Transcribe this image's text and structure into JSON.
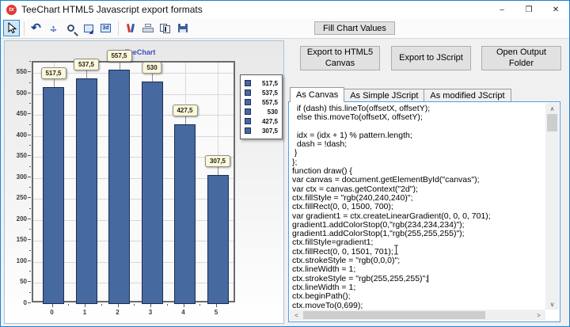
{
  "window": {
    "title": "TeeChart HTML5 Javascript export formats",
    "icon_text": "tx",
    "minimize_glyph": "–",
    "maximize_glyph": "❒",
    "close_glyph": "✕"
  },
  "toolbar": {
    "fill_button_label": "Fill Chart Values",
    "icons": [
      {
        "name": "cursor-icon",
        "selected": true,
        "sep_after": true
      },
      {
        "name": "rotate-icon"
      },
      {
        "name": "move-icon"
      },
      {
        "name": "zoom-icon"
      },
      {
        "name": "export-image-icon"
      },
      {
        "name": "view-3d-icon",
        "sep_after": true
      },
      {
        "name": "tools-icon"
      },
      {
        "name": "print-icon"
      },
      {
        "name": "copy-icon"
      },
      {
        "name": "save-icon"
      }
    ]
  },
  "export_buttons": [
    {
      "label": "Export to HTML5 Canvas"
    },
    {
      "label": "Export to JScript"
    },
    {
      "label": "Open Output Folder"
    }
  ],
  "tabs": [
    {
      "label": "As Canvas",
      "selected": true
    },
    {
      "label": "As Simple JScript",
      "selected": false
    },
    {
      "label": "As modified JScript",
      "selected": false
    }
  ],
  "code": {
    "caret_line": 19,
    "lines": [
      "  if (dash) this.lineTo(offsetX, offsetY);",
      "  else this.moveTo(offsetX, offsetY);",
      "",
      "  idx = (idx + 1) % pattern.length;",
      "  dash = !dash;",
      " }",
      "};",
      "function draw() {",
      "var canvas = document.getElementById(\"canvas\");",
      "var ctx = canvas.getContext(\"2d\");",
      "ctx.fillStyle = \"rgb(240,240,240)\";",
      "ctx.fillRect(0, 0, 1500, 700);",
      "var gradient1 = ctx.createLinearGradient(0, 0, 0, 701);",
      "gradient1.addColorStop(0,\"rgb(234,234,234)\");",
      "gradient1.addColorStop(1,\"rgb(255,255,255)\");",
      "ctx.fillStyle=gradient1;",
      "ctx.fillRect(0, 0, 1501, 701);",
      "ctx.strokeStyle = \"rgb(0,0,0)\";",
      "ctx.lineWidth = 1;",
      "ctx.strokeStyle = \"rgb(255,255,255)\";",
      "ctx.lineWidth = 1;",
      "ctx.beginPath();",
      "ctx.moveTo(0,699);"
    ]
  },
  "chart_data": {
    "type": "bar",
    "title": "TeeChart",
    "categories": [
      "0",
      "1",
      "2",
      "3",
      "4",
      "5"
    ],
    "values": [
      517.5,
      537.5,
      557.5,
      530,
      427.5,
      307.5
    ],
    "value_labels": [
      "517,5",
      "537,5",
      "557,5",
      "530",
      "427,5",
      "307,5"
    ],
    "legend_entries": [
      "517,5",
      "537,5",
      "557,5",
      "530",
      "427,5",
      "307,5"
    ],
    "yticks": [
      0,
      50,
      100,
      150,
      200,
      250,
      300,
      350,
      400,
      450,
      500,
      550
    ],
    "ylim": [
      0,
      575
    ],
    "xlabel": "",
    "ylabel": "",
    "grid": true,
    "legend_position": "right",
    "bar_color": "#46699f",
    "bar_border_color": "#1c2d55",
    "title_color": "#3f51c1",
    "label_box_color": "#fcf8da"
  }
}
